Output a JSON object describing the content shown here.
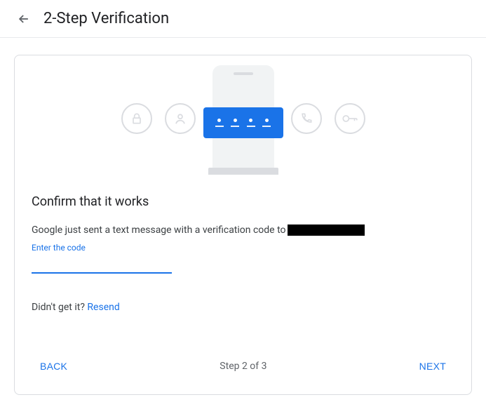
{
  "header": {
    "title": "2-Step Verification"
  },
  "main": {
    "heading": "Confirm that it works",
    "description": "Google just sent a text message with a verification code to",
    "phone_masked": "",
    "input_label": "Enter the code",
    "input_value": "",
    "resend_prompt": "Didn't get it? ",
    "resend_action": "Resend"
  },
  "footer": {
    "back": "Back",
    "step": "Step 2 of 3",
    "next": "Next"
  }
}
